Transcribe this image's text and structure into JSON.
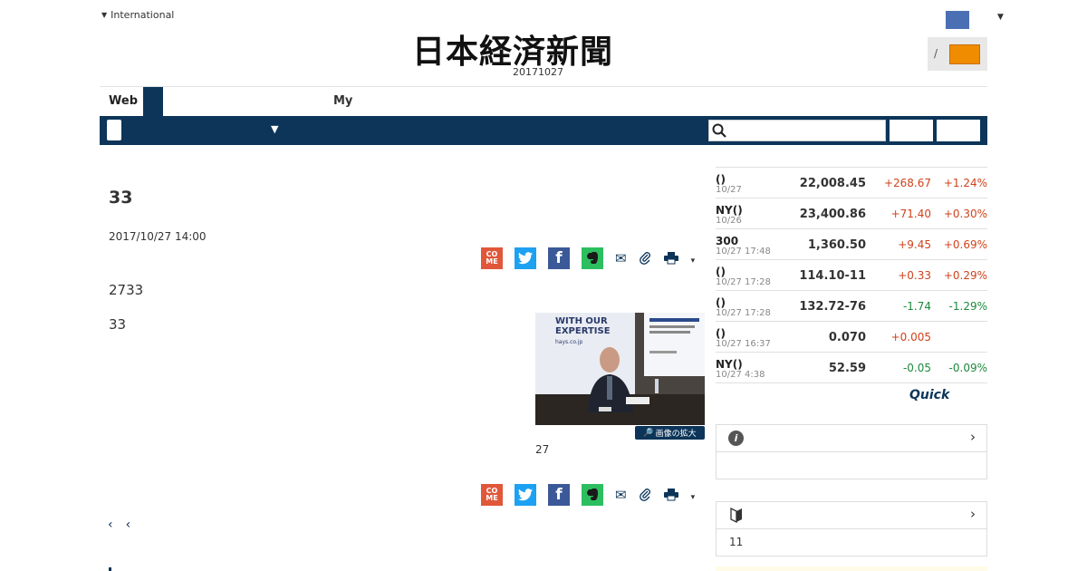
{
  "header": {
    "region_label": "International",
    "logo_text": "日本経済新聞",
    "date": "20171027",
    "login_slash": "/"
  },
  "tabs": [
    {
      "label": "Web"
    },
    {
      "label": "My"
    }
  ],
  "nav": {
    "arrow": "▼",
    "search_placeholder": ""
  },
  "article": {
    "title": "33",
    "timestamp": "2017/10/27 14:00",
    "paragraph1": "2733",
    "paragraph2": "33",
    "photo_caption": "27",
    "zoom_label": "画像の拡大",
    "photo_text": {
      "banner_line1": "WITH OUR",
      "banner_line2": "EXPERTISE",
      "banner_url": "hays.co.jp"
    },
    "pager": [
      "‹",
      "‹"
    ]
  },
  "share": {
    "come_label": "CO ME",
    "caret": "▾"
  },
  "market": {
    "rows": [
      {
        "name": "()",
        "date": "10/27",
        "value": "22,008.45",
        "change": "+268.67",
        "pct": "+1.24%",
        "dir": "up"
      },
      {
        "name": "NY()",
        "date": "10/26",
        "value": "23,400.86",
        "change": "+71.40",
        "pct": "+0.30%",
        "dir": "up"
      },
      {
        "name": "300",
        "date": "10/27 17:48",
        "value": "1,360.50",
        "change": "+9.45",
        "pct": "+0.69%",
        "dir": "up"
      },
      {
        "name": "()",
        "date": "10/27 17:28",
        "value": "114.10-11",
        "change": "+0.33",
        "pct": "+0.29%",
        "dir": "up"
      },
      {
        "name": "()",
        "date": "10/27 17:28",
        "value": "132.72-76",
        "change": "-1.74",
        "pct": "-1.29%",
        "dir": "down"
      },
      {
        "name": "()",
        "date": "10/27 16:37",
        "value": "0.070",
        "change": "+0.005",
        "pct": "",
        "dir": "up"
      },
      {
        "name": "NY()",
        "date": "10/27 4:38",
        "value": "52.59",
        "change": "-0.05",
        "pct": "-0.09%",
        "dir": "down"
      }
    ],
    "provider": "Quick"
  },
  "sidebar": {
    "box1": {
      "icon_text": "i",
      "chevron": "›"
    },
    "box2": {
      "chevron": "›",
      "text": "11"
    }
  },
  "colors": {
    "navy": "#0c3559",
    "orange": "#f08c00",
    "up": "#d0421b",
    "down": "#1c8a3c"
  }
}
